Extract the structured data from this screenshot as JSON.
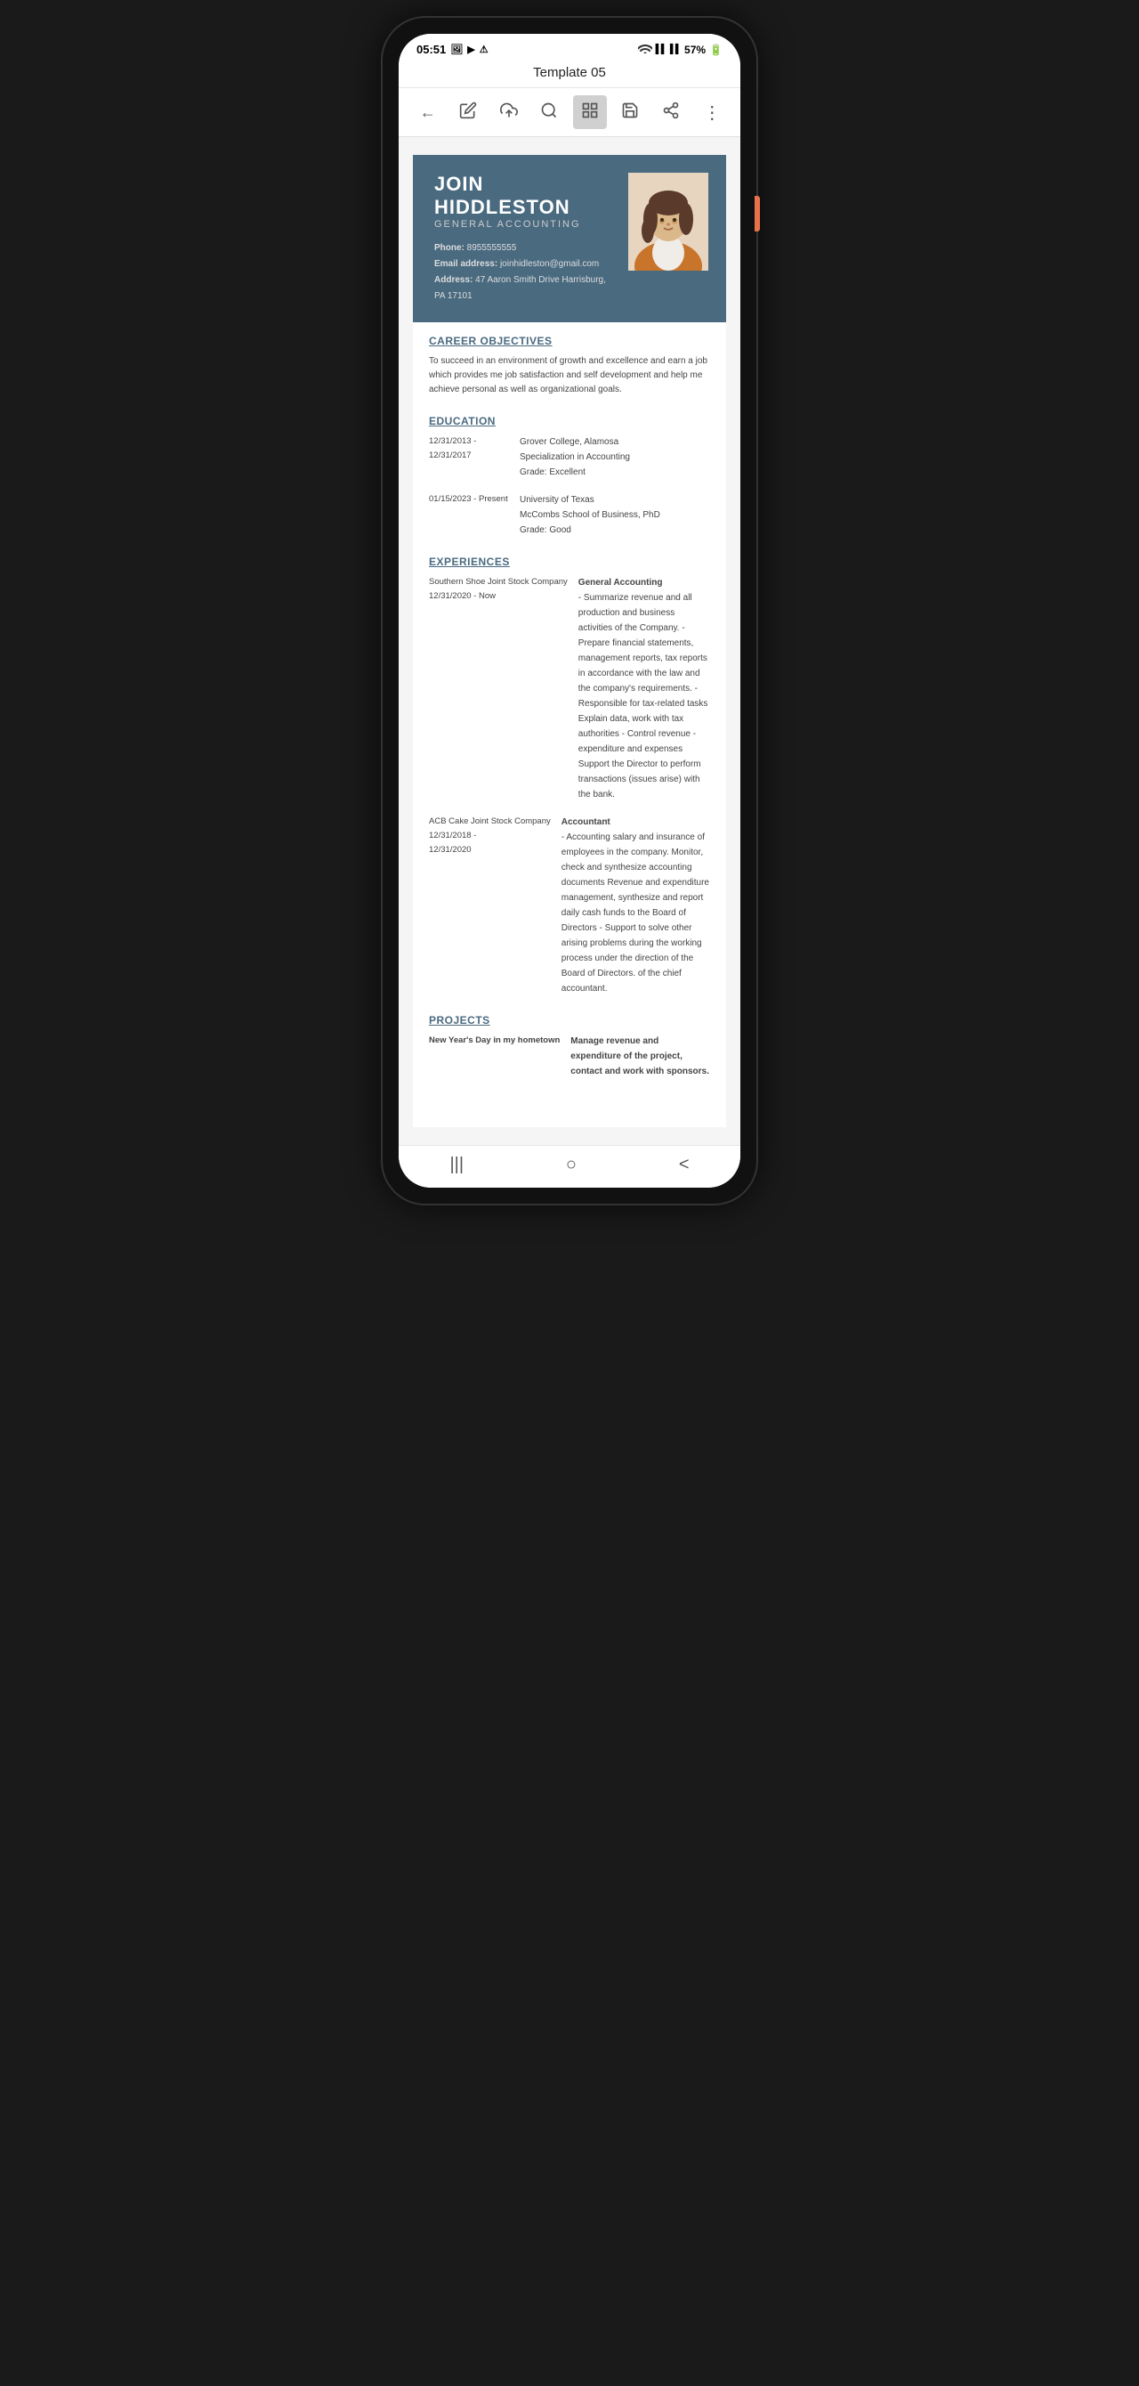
{
  "status": {
    "time": "05:51",
    "battery": "57%",
    "icons": [
      "photo-icon",
      "play-icon",
      "alert-icon"
    ]
  },
  "header": {
    "title": "Template 05"
  },
  "toolbar": {
    "back_label": "←",
    "edit_label": "✎",
    "upload_label": "☁",
    "search_label": "🔍",
    "template_label": "≡",
    "save_label": "💾",
    "share_label": "⬆",
    "more_label": "⋮"
  },
  "resume": {
    "name": "JOIN HIDDLESTON",
    "job_title": "GENERAL ACCOUNTING",
    "phone_label": "Phone:",
    "phone": "8955555555",
    "email_label": "Email address:",
    "email": "joinhidleston@gmail.com",
    "address_label": "Address:",
    "address": "47 Aaron Smith Drive Harrisburg, PA 17101",
    "sections": {
      "objectives": {
        "title": "CAREER OBJECTIVES",
        "text": "To succeed in an environment of growth and excellence and earn a job which provides me job satisfaction and self development and help me achieve personal as well as organizational goals."
      },
      "education": {
        "title": "EDUCATION",
        "items": [
          {
            "dates": "12/31/2013 -\n12/31/2017",
            "school": "Grover College, Alamosa",
            "detail1": "Specialization in Accounting",
            "detail2": "Grade: Excellent"
          },
          {
            "dates": "01/15/2023 - Present",
            "school": "University of Texas",
            "detail1": "McCombs School of Business, PhD",
            "detail2": "Grade: Good"
          }
        ]
      },
      "experiences": {
        "title": "EXPERIENCES",
        "items": [
          {
            "company": "Southern Shoe Joint Stock Company",
            "dates": "12/31/2020 - Now",
            "role": "General Accounting",
            "description": "- Summarize revenue and all production and business activities of the Company.\n- Prepare financial statements, management reports, tax reports in accordance with the law and the company's requirements.\n- Responsible for tax-related tasks Explain data, work with tax authorities - Control revenue - expenditure and expenses Support the Director to perform transactions (issues arise) with the bank."
          },
          {
            "company": "ACB Cake Joint Stock Company",
            "dates": "12/31/2018 -\n12/31/2020",
            "role": "Accountant",
            "description": "- Accounting salary and insurance of employees in the company. Monitor, check and synthesize accounting documents Revenue and expenditure management, synthesize and report daily cash funds to the Board of Directors - Support to solve other arising problems during the working process under the direction of the Board of Directors. of the chief accountant."
          }
        ]
      },
      "projects": {
        "title": "PROJECTS",
        "items": [
          {
            "name": "New Year's Day in my hometown",
            "detail": "Manage revenue and expenditure of the project, contact and work with sponsors."
          }
        ]
      }
    }
  },
  "bottom_nav": {
    "lines_label": "|||",
    "circle_label": "○",
    "back_label": "<"
  }
}
